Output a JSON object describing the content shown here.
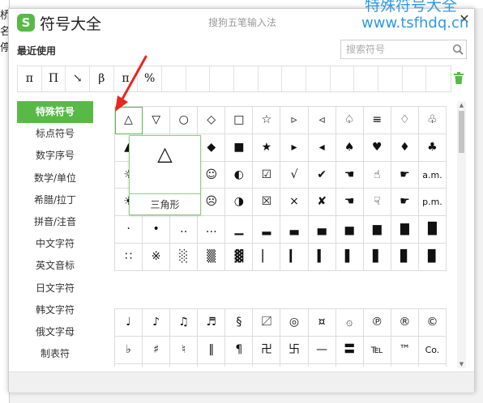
{
  "app": {
    "title": "符号大全",
    "subtitle": "搜狗五笔输入法",
    "logo": "S",
    "close": "✕"
  },
  "watermark": {
    "line1": "特殊符号大全",
    "line2": "www.tsfhdq.cn"
  },
  "background": {
    "left_chars": [
      "桥",
      "名",
      "停"
    ]
  },
  "recent": {
    "label": "最近使用",
    "symbols": [
      "π",
      "Π",
      "↘",
      "β",
      "π",
      "%",
      "",
      "",
      "",
      "",
      "",
      "",
      "",
      "",
      "",
      "",
      "",
      ""
    ]
  },
  "search": {
    "placeholder": "搜索符号"
  },
  "categories": [
    {
      "label": "特殊符号",
      "active": true
    },
    {
      "label": "标点符号"
    },
    {
      "label": "数字序号"
    },
    {
      "label": "数学/单位"
    },
    {
      "label": "希腊/拉丁"
    },
    {
      "label": "拼音/注音"
    },
    {
      "label": "中文字符"
    },
    {
      "label": "英文音标"
    },
    {
      "label": "日文字符"
    },
    {
      "label": "韩文字符"
    },
    {
      "label": "俄文字母"
    },
    {
      "label": "制表符"
    }
  ],
  "grid1": [
    [
      "△",
      "▽",
      "○",
      "◇",
      "□",
      "☆",
      "▹",
      "◃",
      "♤",
      "≡",
      "♢",
      "♧"
    ],
    [
      "▲",
      "▼",
      "●",
      "◆",
      "■",
      "★",
      "▸",
      "◂",
      "♠",
      "♥",
      "♦",
      "♣"
    ],
    [
      "☼",
      "☾",
      "☽",
      "☺",
      "◐",
      "☑",
      "√",
      "✔",
      "☚",
      "☝",
      "☛",
      "a.m."
    ],
    [
      "☀",
      "☁",
      "☂",
      "☹",
      "◑",
      "☒",
      "×",
      "✘",
      "☚",
      "☟",
      "☛",
      "p.m."
    ],
    [
      "·",
      "•",
      "‥",
      "…",
      "▁",
      "▂",
      "▃",
      "▄",
      "▅",
      "▆",
      "▇",
      "█"
    ],
    [
      "∷",
      "※",
      "░",
      "▒",
      "▓",
      "▏",
      "▎",
      "▍",
      "▌",
      "▋",
      "▊",
      "▉"
    ]
  ],
  "grid2": [
    [
      "♩",
      "♪",
      "♫",
      "♬",
      "§",
      "〼",
      "◎",
      "¤",
      "۞",
      "℗",
      "®",
      "©"
    ],
    [
      "♭",
      "♯",
      "♮",
      "‖",
      "¶",
      "卍",
      "卐",
      "—",
      "〓",
      "℡",
      "™",
      "Co."
    ],
    [
      "",
      "",
      "",
      "",
      "",
      "",
      "",
      "",
      "",
      "",
      "",
      ""
    ]
  ],
  "preview": {
    "symbol": "△",
    "name": "三角形"
  },
  "colors": {
    "accent": "#58b947",
    "watermark": "#2f9ae0",
    "arrow": "#e8281e"
  }
}
